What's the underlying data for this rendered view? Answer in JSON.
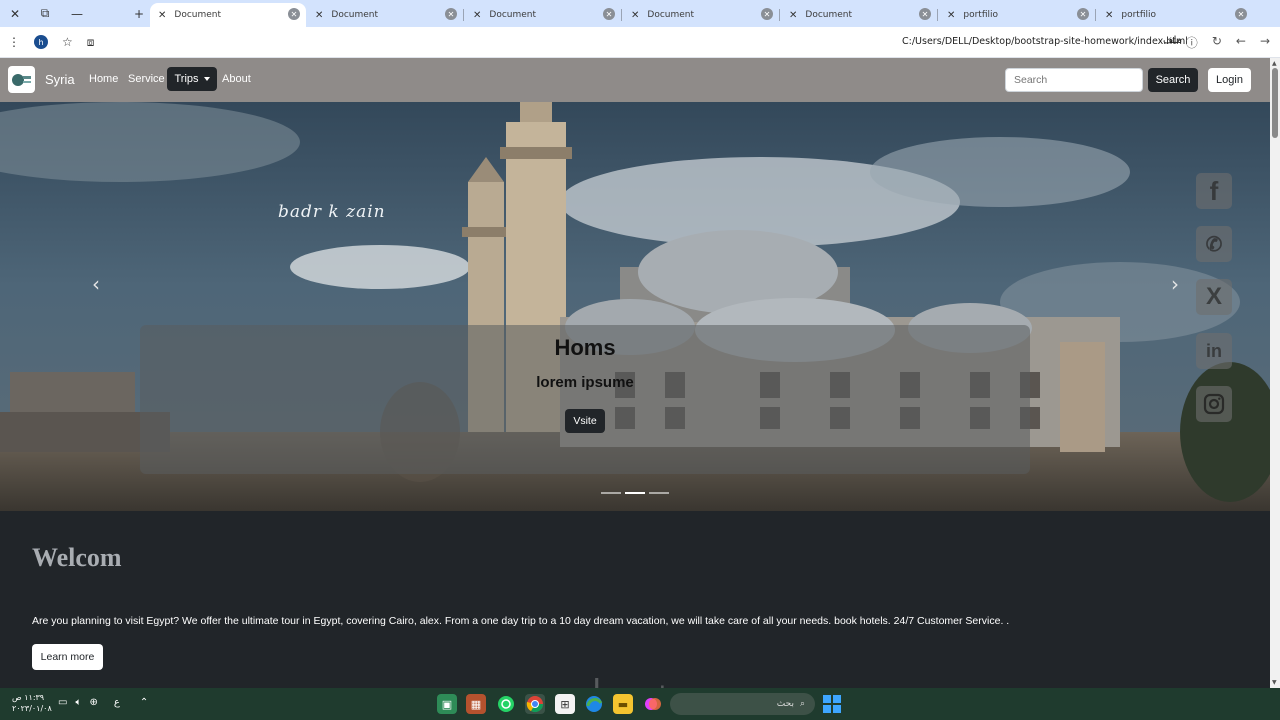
{
  "browser": {
    "tabs": [
      {
        "title": "Document",
        "active": true
      },
      {
        "title": "Document",
        "active": false
      },
      {
        "title": "Document",
        "active": false
      },
      {
        "title": "Document",
        "active": false
      },
      {
        "title": "Document",
        "active": false
      },
      {
        "title": "portfilio",
        "active": false
      },
      {
        "title": "portfilio",
        "active": false
      }
    ],
    "url": "C:/Users/DELL/Desktop/bootstrap-site-homework/index.html",
    "url_label": "ملف",
    "profile_initial": "h"
  },
  "navbar": {
    "brand": "Syria",
    "links": [
      "Home",
      "Service",
      "Trips",
      "About"
    ],
    "search_placeholder": "Search",
    "search_button": "Search",
    "login_button": "Login"
  },
  "carousel": {
    "signature": "badr k zain",
    "caption_title": "Homs",
    "caption_subtitle": "lorem ipsume",
    "caption_button": "Vsite",
    "slides": 3,
    "active_slide": 2
  },
  "social": [
    "facebook-icon",
    "whatsapp-icon",
    "x-icon",
    "linkedin-icon",
    "instagram-icon"
  ],
  "welcome": {
    "title": "Welcom",
    "text": "Are you planning to visit Egypt? We offer the ultimate tour in Egypt, covering Cairo, alex. From a one day trip to a 10 day dream vacation, we will take care of all your needs. book hotels. 24/7 Customer Service. .",
    "button": "Learn more"
  },
  "taskbar": {
    "time": "١١:٣٩ ص",
    "date": "٢٠٢٣/٠١/٠٨",
    "search_label": "بحث",
    "lang": "ع"
  },
  "colors": {
    "navbar_bg": "#8f8b89",
    "dark": "#212529",
    "tab_strip": "#d3e3fd"
  }
}
